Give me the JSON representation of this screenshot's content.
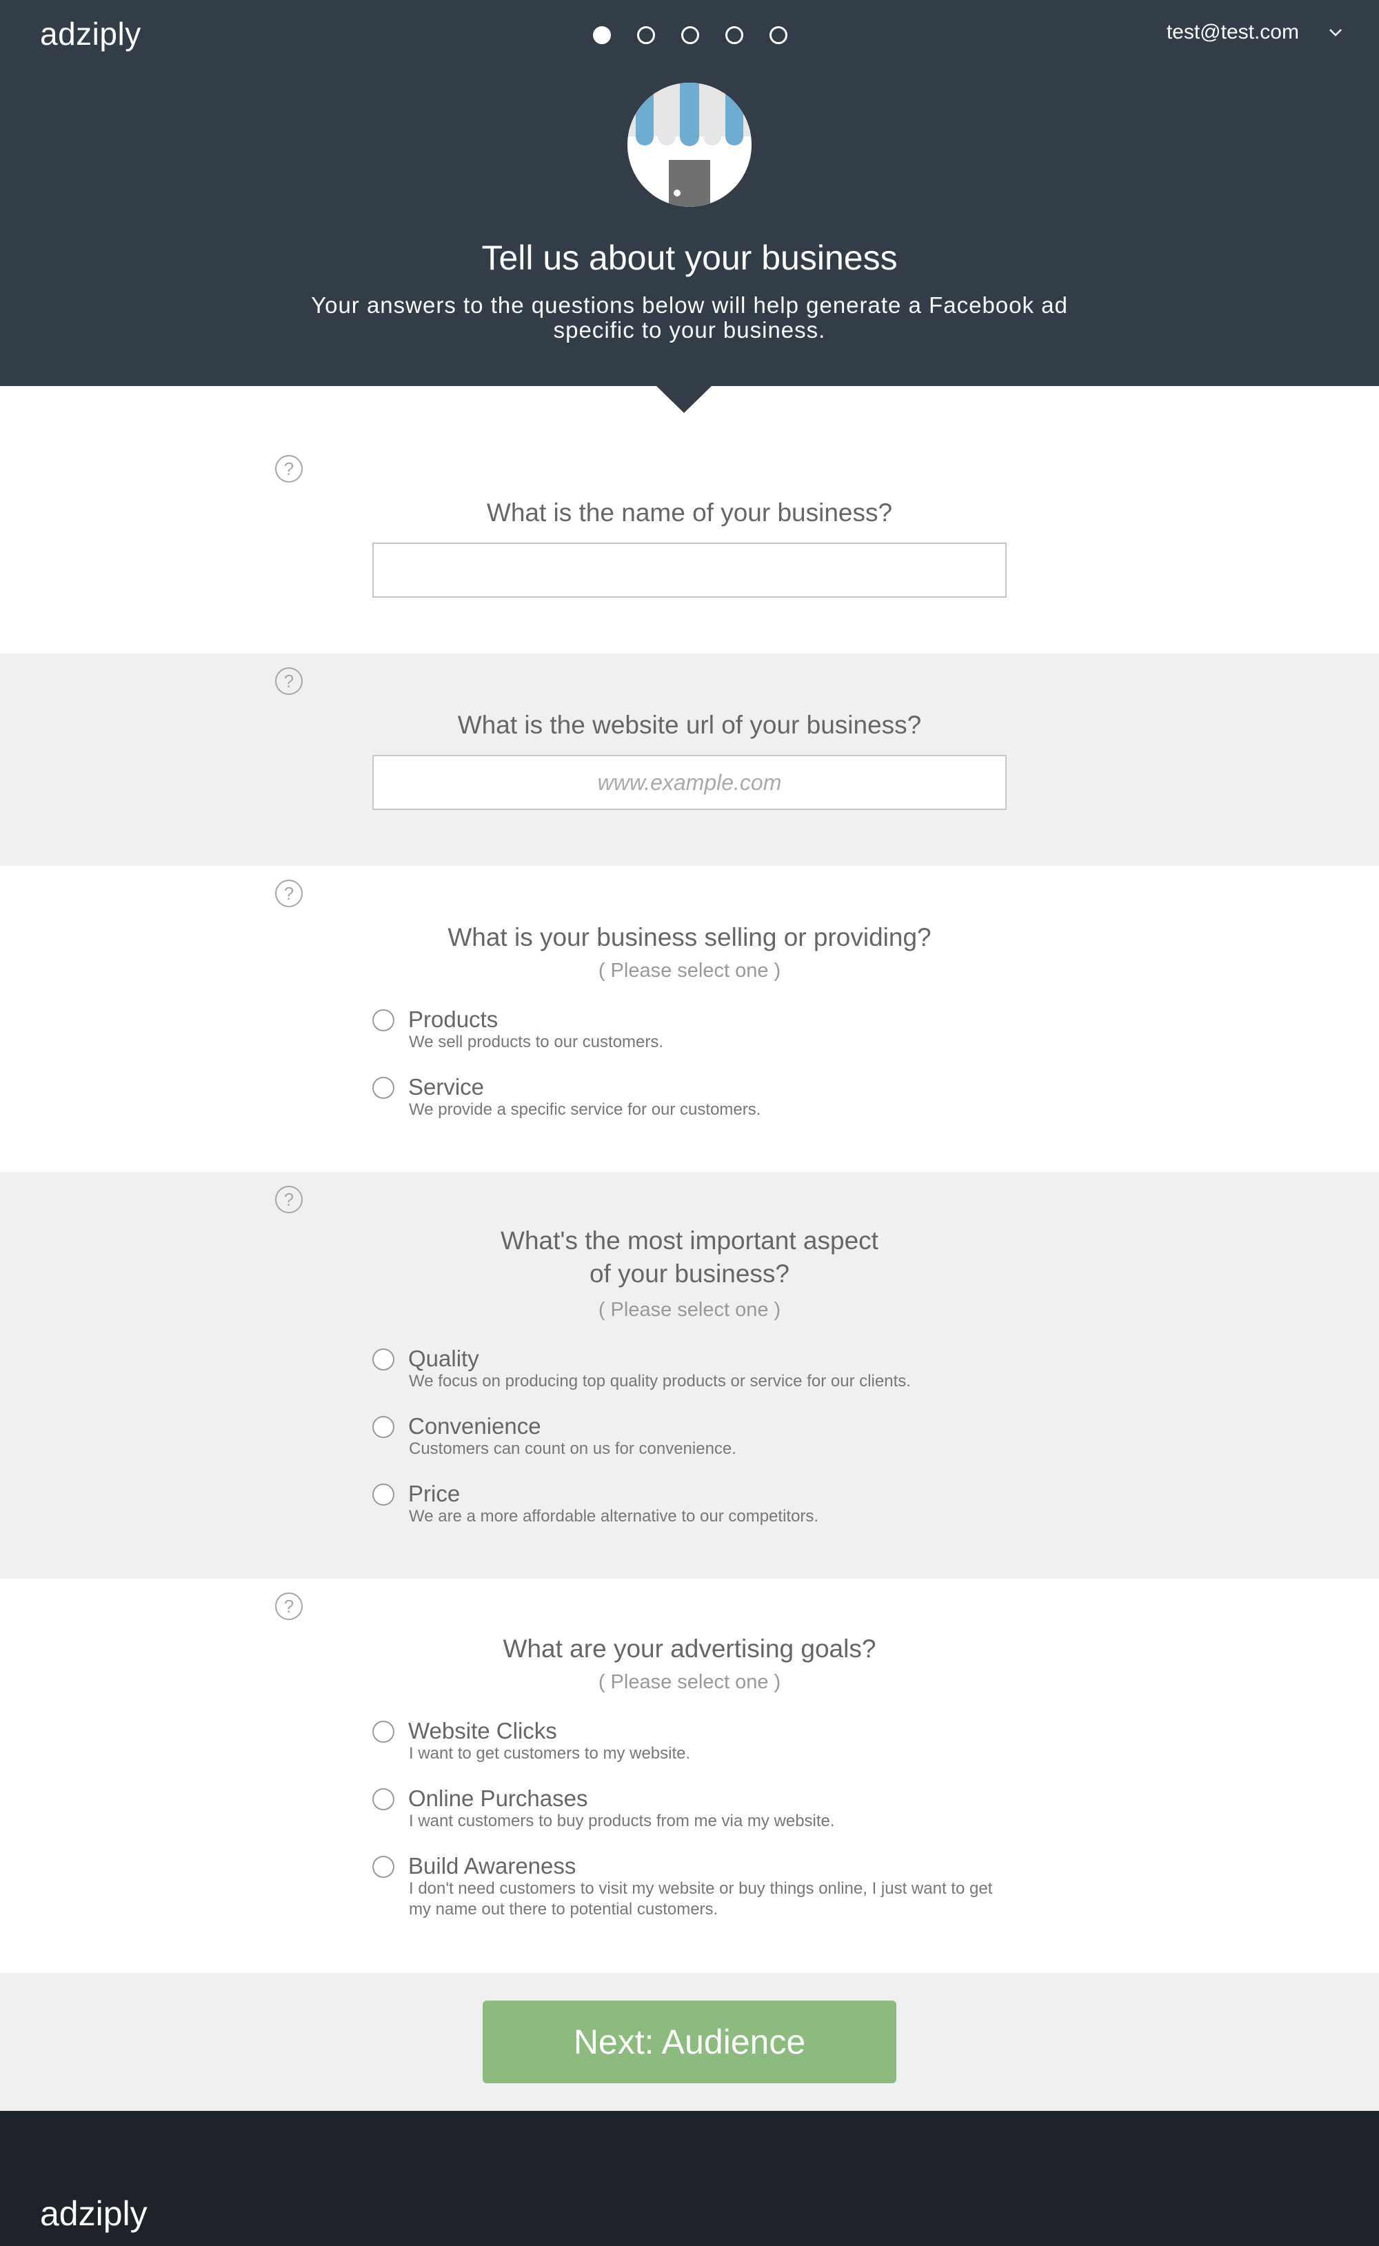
{
  "header": {
    "logo": "adziply",
    "user_email": "test@test.com",
    "steps": [
      true,
      false,
      false,
      false,
      false
    ],
    "title": "Tell us about your business",
    "subtitle": "Your answers to the questions below will help generate a Facebook ad specific to your business."
  },
  "icons": {
    "help": "?",
    "store": "storefront-icon",
    "chevron": "chevron-down-icon"
  },
  "questions": {
    "name": {
      "label": "What is the name of your business?",
      "value": "",
      "placeholder": ""
    },
    "website": {
      "label": "What is the website url of your business?",
      "value": "",
      "placeholder": "www.example.com"
    },
    "selling": {
      "label": "What is your business selling or providing?",
      "hint": "( Please select one )",
      "options": [
        {
          "label": "Products",
          "desc": "We sell products to our customers."
        },
        {
          "label": "Service",
          "desc": "We provide a specific service for our customers."
        }
      ]
    },
    "aspect": {
      "label_line1": "What's the most important aspect",
      "label_line2": "of your business?",
      "hint": "( Please select one )",
      "options": [
        {
          "label": "Quality",
          "desc": "We focus on producing top quality products or service for our clients."
        },
        {
          "label": "Convenience",
          "desc": "Customers can count on us for convenience."
        },
        {
          "label": "Price",
          "desc": "We are a more affordable alternative to our competitors."
        }
      ]
    },
    "goals": {
      "label": "What are your advertising goals?",
      "hint": "( Please select one )",
      "options": [
        {
          "label": "Website Clicks",
          "desc": "I want to get customers to my website."
        },
        {
          "label": "Online Purchases",
          "desc": "I want customers to buy products from me via my website."
        },
        {
          "label": "Build Awareness",
          "desc": "I don't need customers to visit my website or buy things online, I just want to get my name out there to potential customers."
        }
      ]
    }
  },
  "next_button": "Next: Audience",
  "footer": {
    "logo": "adziply"
  },
  "colors": {
    "header_bg": "#333d47",
    "section_gray": "#f0f0f0",
    "button_green": "#8dbb7f",
    "footer_bg": "#1e232a",
    "awning_blue": "#6eadd1"
  }
}
